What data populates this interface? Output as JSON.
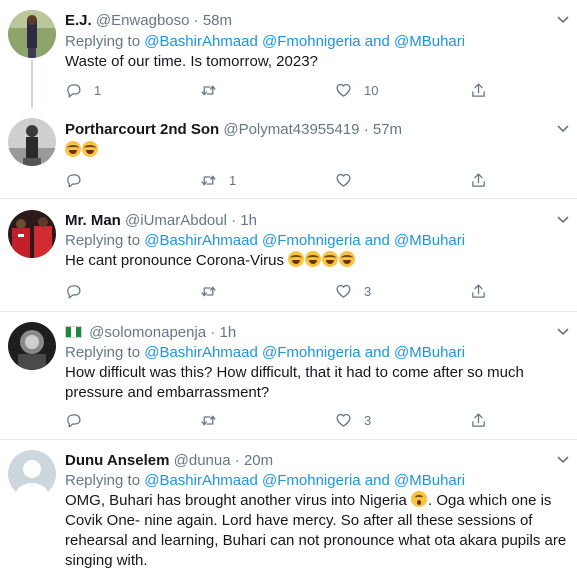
{
  "tweets": [
    {
      "name": "E.J.",
      "handle": "@Enwagboso",
      "time": "58m",
      "replying_prefix": "Replying to",
      "mentions": [
        "@BashirAhmaad",
        "@Fmohnigeria",
        "and",
        "@MBuhari"
      ],
      "text": "Waste of our time. Is tomorrow, 2023?",
      "replies": "1",
      "retweets": "",
      "likes": "10"
    },
    {
      "name": "Portharcourt 2nd Son",
      "handle": "@Polymat43955419",
      "time": "57m",
      "text": "",
      "emoji_count": 2,
      "replies": "",
      "retweets": "1",
      "likes": ""
    },
    {
      "name": "Mr. Man",
      "handle": "@iUmarAbdoul",
      "time": "1h",
      "replying_prefix": "Replying to",
      "mentions": [
        "@BashirAhmaad",
        "@Fmohnigeria",
        "and",
        "@MBuhari"
      ],
      "text": "He cant pronounce Corona-Virus",
      "emoji_count": 4,
      "replies": "",
      "retweets": "",
      "likes": "3"
    },
    {
      "name": "",
      "handle": "@solomonapenja",
      "time": "1h",
      "replying_prefix": "Replying to",
      "mentions": [
        "@BashirAhmaad",
        "@Fmohnigeria",
        "and",
        "@MBuhari"
      ],
      "text": "How difficult was this? How difficult, that it had to come after so much pressure and embarrassment?",
      "replies": "",
      "retweets": "",
      "likes": "3"
    },
    {
      "name": "Dunu Anselem",
      "handle": "@dunua",
      "time": "20m",
      "replying_prefix": "Replying to",
      "mentions": [
        "@BashirAhmaad",
        "@Fmohnigeria",
        "and",
        "@MBuhari"
      ],
      "text_part1": "OMG, Buhari has brought another virus into Nigeria",
      "text_part2": ". Oga which one is Covik One- nine again. Lord have mercy. So after all these sessions of rehearsal and learning, Buhari can not pronounce what  ota akara pupils are singing with."
    }
  ],
  "separator": "·",
  "colors": {
    "accent": "#1b95e0",
    "muted": "#657786",
    "border": "#e6ecf0"
  },
  "icons": [
    "reply-icon",
    "retweet-icon",
    "like-icon",
    "share-icon",
    "caret-down-icon"
  ]
}
